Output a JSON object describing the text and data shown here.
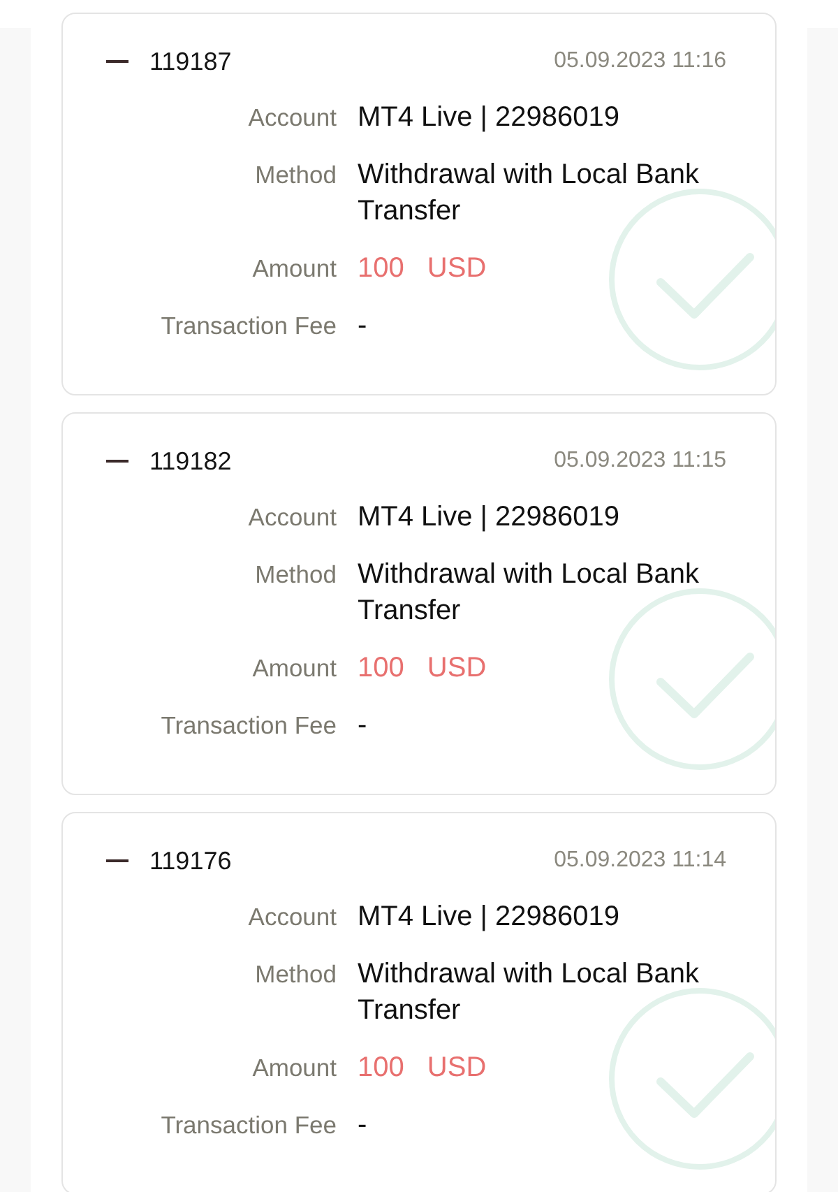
{
  "transactions": [
    {
      "expanded": true,
      "id": "119187",
      "date": "05.09.2023 11:16",
      "completed": true,
      "fields": [
        {
          "kind": "text",
          "name": "Account",
          "value": "MT4 Live | 22986019"
        },
        {
          "kind": "text",
          "name": "Method",
          "value": "Withdrawal with Local Bank Transfer"
        },
        {
          "kind": "amount",
          "name": "Amount",
          "value": "100 USD"
        },
        {
          "kind": "text",
          "name": "Transaction Fee",
          "value": "-"
        }
      ]
    },
    {
      "expanded": true,
      "id": "119182",
      "date": "05.09.2023 11:15",
      "completed": true,
      "fields": [
        {
          "kind": "text",
          "name": "Account",
          "value": "MT4 Live | 22986019"
        },
        {
          "kind": "text",
          "name": "Method",
          "value": "Withdrawal with Local Bank Transfer"
        },
        {
          "kind": "amount",
          "name": "Amount",
          "value": "100 USD"
        },
        {
          "kind": "text",
          "name": "Transaction Fee",
          "value": "-"
        }
      ]
    },
    {
      "expanded": true,
      "id": "119176",
      "date": "05.09.2023 11:14",
      "completed": true,
      "fields": [
        {
          "kind": "text",
          "name": "Account",
          "value": "MT4 Live | 22986019"
        },
        {
          "kind": "text",
          "name": "Method",
          "value": "Withdrawal with Local Bank Transfer"
        },
        {
          "kind": "amount",
          "name": "Amount",
          "value": "100 USD"
        },
        {
          "kind": "text",
          "name": "Transaction Fee",
          "value": "-"
        }
      ]
    }
  ]
}
